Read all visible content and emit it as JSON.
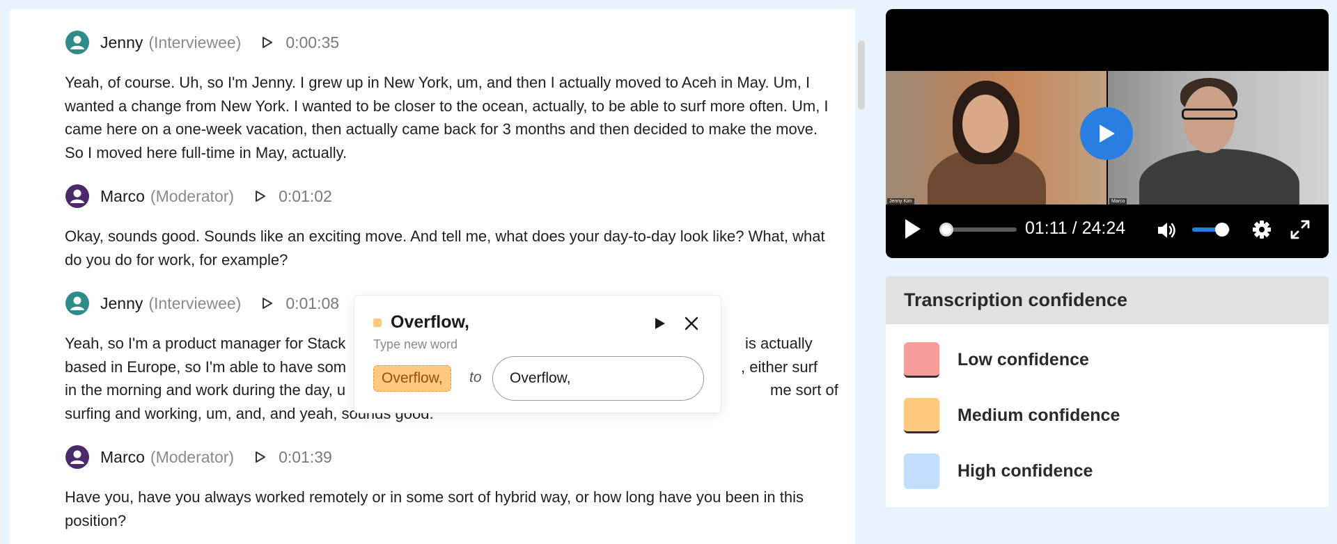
{
  "colors": {
    "low": "#f79e9a",
    "medium": "#ffc980",
    "high": "#c1defc",
    "accent": "#2a7de1",
    "page_bg": "#e9f3fd"
  },
  "transcript": {
    "entries": [
      {
        "speaker": "Jenny",
        "role": "(Interviewee)",
        "time": "0:00:35",
        "text": "Yeah, of course. Uh, so I'm Jenny. I grew up in New York, um, and then I actually moved to Aceh in May. Um, I wanted a change from New York. I wanted to be closer to the ocean, actually, to be able to surf more often. Um, I came here on a one-week vacation, then actually came back for 3 months and then decided to make the move. So I moved here full-time in May, actually."
      },
      {
        "speaker": "Marco",
        "role": "(Moderator)",
        "time": "0:01:02",
        "text": "Okay, sounds good. Sounds like an exciting move. And tell me, what does your day-to-day look like? What, what do you do for work, for example?"
      },
      {
        "speaker": "Jenny",
        "role": "(Interviewee)",
        "time": "0:01:08",
        "text": "Yeah, so I'm a product manager for Stack is actually based in Europe, so I'm able to have som , either surf in the morning and work during the day, u me sort of surfing and working, um, and, and yeah, sounds good."
      },
      {
        "speaker": "Marco",
        "role": "(Moderator)",
        "time": "0:01:39",
        "text": "Have you, have you always worked remotely or in some sort of hybrid way, or how long have you been in this position?"
      }
    ],
    "partial_lines": {
      "l1a": "Yeah, so I'm a product manager for Stack",
      "l1b": "is actually",
      "l2a": "based in Europe, so I'm able to have som",
      "l2b": ", either surf",
      "l3a": "in the morning and work during the day, u",
      "l3b": "me sort of",
      "l4": "surfing and working, um, and, and yeah, sounds good."
    }
  },
  "popup": {
    "word": "Overflow,",
    "hint": "Type new word",
    "original": "Overflow,",
    "to": "to",
    "input_value": "Overflow,"
  },
  "video": {
    "current_time": "01:11",
    "separator": "/",
    "duration": "24:24",
    "progress": 0.049,
    "volume": 0.8,
    "left_cam_label": "Jenny Kim",
    "right_cam_label": "Marco"
  },
  "legend": {
    "title": "Transcription confidence",
    "items": [
      {
        "label": "Low confidence"
      },
      {
        "label": "Medium confidence"
      },
      {
        "label": "High confidence"
      }
    ]
  }
}
